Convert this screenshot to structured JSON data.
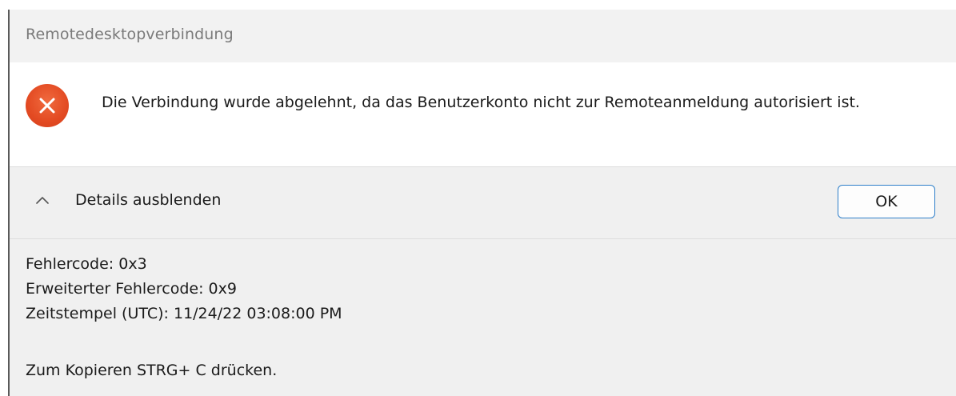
{
  "window": {
    "title": "Remotedesktopverbindung"
  },
  "message": {
    "icon": "error-icon",
    "text": "Die Verbindung wurde abgelehnt, da das Benutzerkonto nicht zur Remoteanmeldung autorisiert ist."
  },
  "actions": {
    "details_toggle_label": "Details ausblenden",
    "details_toggle_icon": "chevron-up-icon",
    "ok_label": "OK"
  },
  "details": {
    "error_code": "Fehlercode: 0x3",
    "extended_error_code": "Erweiterter Fehlercode: 0x9",
    "timestamp": "Zeitstempel (UTC): 11/24/22 03:08:00 PM",
    "copy_hint": "Zum Kopieren STRG+ C drücken."
  },
  "colors": {
    "error_icon": "#e34a22",
    "ok_border": "#2f7fc9",
    "title_text": "#7a7a7a"
  }
}
